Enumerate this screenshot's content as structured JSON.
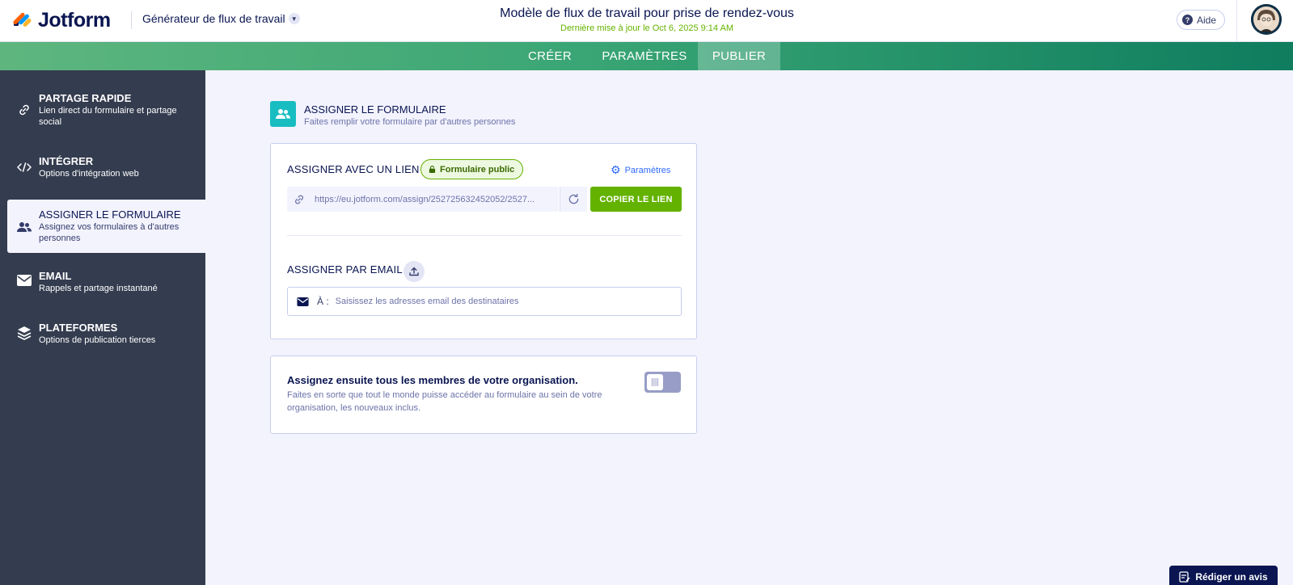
{
  "header": {
    "logo_text": "Jotform",
    "builder_label": "Générateur de flux de travail",
    "title": "Modèle de flux de travail pour prise de rendez-vous",
    "subtitle": "Dernière mise à jour le Oct 6, 2025 9:14 AM",
    "help_label": "Aide",
    "help_glyph": "?"
  },
  "tabs": [
    {
      "label": "CRÉER",
      "active": false
    },
    {
      "label": "PARAMÈTRES",
      "active": false
    },
    {
      "label": "PUBLIER",
      "active": true
    }
  ],
  "sidebar": {
    "items": [
      {
        "label": "PARTAGE RAPIDE",
        "sub": "Lien direct du formulaire et partage social",
        "icon": "link-icon",
        "active": false
      },
      {
        "label": "INTÉGRER",
        "sub": "Options d'intégration web",
        "icon": "code-icon",
        "active": false
      },
      {
        "label": "ASSIGNER LE FORMULAIRE",
        "sub": "Assignez vos formulaires à d'autres personnes",
        "icon": "users-icon",
        "active": true
      },
      {
        "label": "EMAIL",
        "sub": "Rappels et partage instantané",
        "icon": "envelope-icon",
        "active": false
      },
      {
        "label": "PLATEFORMES",
        "sub": "Options de publication tierces",
        "icon": "layers-icon",
        "active": false
      }
    ]
  },
  "section": {
    "title": "ASSIGNER LE FORMULAIRE",
    "description": "Faites remplir votre formulaire par d'autres personnes"
  },
  "assign_link": {
    "title": "ASSIGNER AVEC UN LIEN",
    "badge": "Formulaire public",
    "settings_label": "Paramètres",
    "url": "https://eu.jotform.com/assign/252725632452052/2527...",
    "copy_label": "COPIER LE LIEN"
  },
  "assign_email": {
    "title": "ASSIGNER PAR EMAIL",
    "to_label": "À :",
    "placeholder": "Saisissez les adresses email des destinataires"
  },
  "org": {
    "title": "Assignez ensuite tous les membres de votre organisation.",
    "description": "Faites en sorte que tout le monde puisse accéder au formulaire au sein de votre organisation, les nouveaux inclus.",
    "toggle_on": false
  },
  "feedback_label": "Rédiger un avis",
  "colors": {
    "accent_green": "#64b200",
    "navy": "#0a1551",
    "sidebar_bg": "#343c4f",
    "teal": "#18bdc1",
    "blue_link": "#2e69ff"
  }
}
